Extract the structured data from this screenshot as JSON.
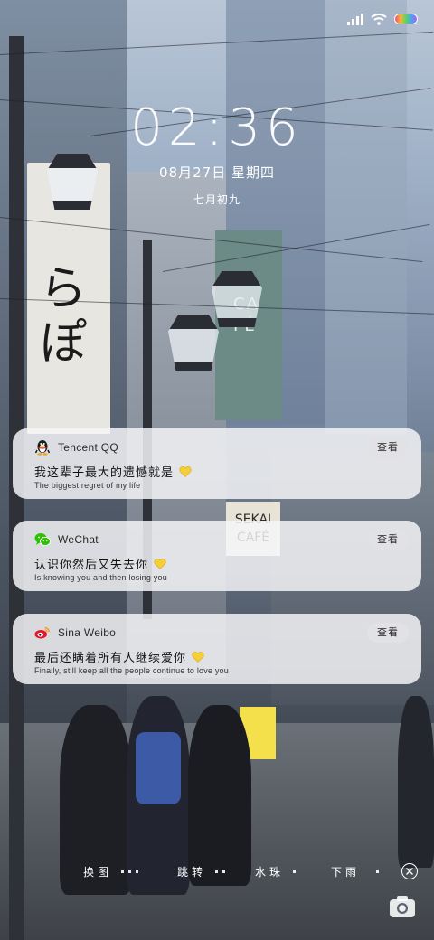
{
  "status_bar": {
    "signal_icon": "signal-icon",
    "wifi_icon": "wifi-icon",
    "battery_icon": "battery-icon"
  },
  "lockscreen": {
    "time": "02:36",
    "date": "08月27日 星期四",
    "lunar_date": "七月初九"
  },
  "notifications": [
    {
      "app": "Tencent QQ",
      "icon": "qq-penguin-icon",
      "action_label": "查看",
      "message": "我这辈子最大的遗憾就是",
      "subtext": "The biggest regret of my life"
    },
    {
      "app": "WeChat",
      "icon": "wechat-icon",
      "action_label": "查看",
      "message": "认识你然后又失去你",
      "subtext": "Is knowing you and then losing you"
    },
    {
      "app": "Sina Weibo",
      "icon": "weibo-icon",
      "action_label": "查看",
      "message": "最后还瞒着所有人继续爱你",
      "subtext": "Finally, still keep all the people continue to love you"
    }
  ],
  "bottom_bar": {
    "items": [
      "换图",
      "跳转",
      "水珠",
      "下雨"
    ],
    "close_icon": "close-icon",
    "camera_icon": "camera-icon"
  },
  "colors": {
    "heart": "#f5cf3a",
    "qq": "#1c1c1c",
    "wechat": "#2dc100",
    "weibo": "#e6162d"
  }
}
